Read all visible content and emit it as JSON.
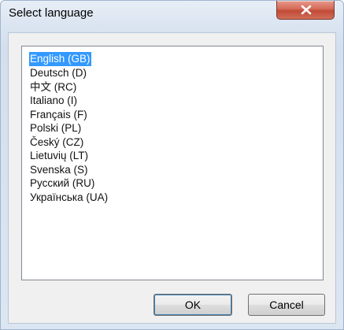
{
  "window": {
    "title": "Select language"
  },
  "list": {
    "items": [
      {
        "label": "English (GB)",
        "selected": true
      },
      {
        "label": "Deutsch (D)",
        "selected": false
      },
      {
        "label": "中文 (RC)",
        "selected": false
      },
      {
        "label": "Italiano (I)",
        "selected": false
      },
      {
        "label": "Français (F)",
        "selected": false
      },
      {
        "label": "Polski (PL)",
        "selected": false
      },
      {
        "label": "Český (CZ)",
        "selected": false
      },
      {
        "label": "Lietuvių (LT)",
        "selected": false
      },
      {
        "label": "Svenska (S)",
        "selected": false
      },
      {
        "label": "Русский (RU)",
        "selected": false
      },
      {
        "label": "Українська (UA)",
        "selected": false
      }
    ]
  },
  "buttons": {
    "ok_label": "OK",
    "cancel_label": "Cancel"
  },
  "icons": {
    "close": "close-icon"
  },
  "colors": {
    "selection": "#3399ff",
    "close_button": "#c94f3c"
  }
}
